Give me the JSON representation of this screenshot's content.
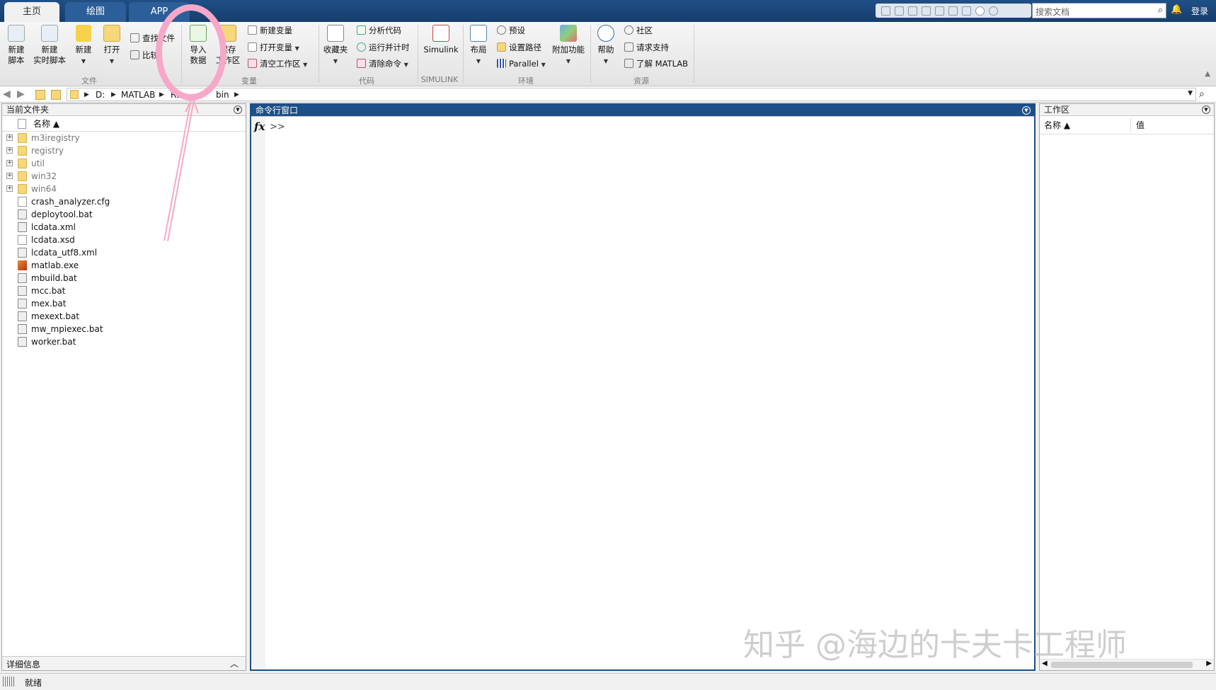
{
  "tabs": [
    {
      "label": "主页"
    },
    {
      "label": "绘图"
    },
    {
      "label": "APP"
    }
  ],
  "search": {
    "placeholder": "搜索文档"
  },
  "account": {
    "login": "登录"
  },
  "ribbon": {
    "file": {
      "new_script": "新建\n脚本",
      "new_live_script": "新建\n实时脚本",
      "new": "新建",
      "open": "打开",
      "find_files": "查找文件",
      "compare": "比较",
      "group": "文件"
    },
    "variable": {
      "import_data": "导入\n数据",
      "save_workspace": "保存\n工作区",
      "new_variable": "新建变量",
      "open_variable": "打开变量",
      "clear_workspace": "清空工作区",
      "group": "变量"
    },
    "code": {
      "favorites": "收藏夹",
      "analyze": "分析代码",
      "run_time": "运行并计时",
      "clear_commands": "清除命令",
      "group": "代码"
    },
    "simulink": {
      "label": "Simulink",
      "group": "SIMULINK"
    },
    "environment": {
      "layout": "布局",
      "preferences": "预设",
      "set_path": "设置路径",
      "parallel": "Parallel",
      "addons": "附加功能",
      "group": "环境"
    },
    "resources": {
      "help": "帮助",
      "community": "社区",
      "support": "请求支持",
      "learn": "了解 MATLAB",
      "group": "资源"
    }
  },
  "address": {
    "crumbs": [
      "D:",
      "MATLAB",
      "R2",
      "bin"
    ]
  },
  "current_folder": {
    "title": "当前文件夹",
    "col_name": "名称 ▲",
    "details": "详细信息",
    "files": [
      {
        "name": "m3iregistry",
        "type": "folder"
      },
      {
        "name": "registry",
        "type": "folder"
      },
      {
        "name": "util",
        "type": "folder"
      },
      {
        "name": "win32",
        "type": "folder"
      },
      {
        "name": "win64",
        "type": "folder"
      },
      {
        "name": "crash_analyzer.cfg",
        "type": "doc"
      },
      {
        "name": "deploytool.bat",
        "type": "bat"
      },
      {
        "name": "lcdata.xml",
        "type": "bat"
      },
      {
        "name": "lcdata.xsd",
        "type": "doc"
      },
      {
        "name": "lcdata_utf8.xml",
        "type": "bat"
      },
      {
        "name": "matlab.exe",
        "type": "exe"
      },
      {
        "name": "mbuild.bat",
        "type": "bat"
      },
      {
        "name": "mcc.bat",
        "type": "bat"
      },
      {
        "name": "mex.bat",
        "type": "bat"
      },
      {
        "name": "mexext.bat",
        "type": "bat"
      },
      {
        "name": "mw_mpiexec.bat",
        "type": "bat"
      },
      {
        "name": "worker.bat",
        "type": "bat"
      }
    ]
  },
  "command_window": {
    "title": "命令行窗口",
    "fx": "fx",
    "prompt": ">>"
  },
  "workspace": {
    "title": "工作区",
    "col_name": "名称 ▲",
    "col_value": "值"
  },
  "status": {
    "text": "就绪"
  },
  "watermark": "知乎 @海边的卡夫卡工程师"
}
